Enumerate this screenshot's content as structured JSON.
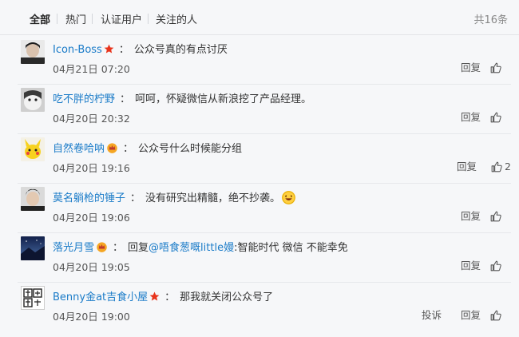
{
  "tabs": [
    {
      "label": "全部"
    },
    {
      "label": "热门"
    },
    {
      "label": "认证用户"
    },
    {
      "label": "关注的人"
    }
  ],
  "total_count": "共16条",
  "reply_label": "回复",
  "report_label": "投诉",
  "colon": "：",
  "comments": [
    {
      "username": "Icon-Boss",
      "content": "公众号真的有点讨厌",
      "time": "04月21日 07:20"
    },
    {
      "username": "吃不胖的柠野",
      "content": "呵呵，怀疑微信从新浪挖了产品经理。",
      "time": "04月20日 20:32"
    },
    {
      "username": "自然卷哈呐",
      "content": "公众号什么时候能分组",
      "time": "04月20日 19:16",
      "likes": "2"
    },
    {
      "username": "莫名躺枪的锤子",
      "content": "没有研究出精髓，绝不抄袭。",
      "time": "04月20日 19:06"
    },
    {
      "username": "落光月雪",
      "content_prefix": "回复",
      "mention": "@唔食葱嘅little嫚",
      "content": ":智能时代 微信 不能幸免",
      "time": "04月20日 19:05"
    },
    {
      "username": "Benny金at吉食小屋",
      "content": "那我就关闭公众号了",
      "time": "04月20日 19:00"
    }
  ],
  "colors": {
    "link": "#1a7bc8",
    "text": "#333333",
    "meta": "#555555",
    "star_badge": "#e8341c",
    "crown_badge": "#f5a623"
  },
  "icons": {
    "like": "thumbs-up-icon",
    "verified_star": "star-badge-icon",
    "crown": "crown-badge-icon",
    "laugh": "laughing-emoji-icon"
  }
}
